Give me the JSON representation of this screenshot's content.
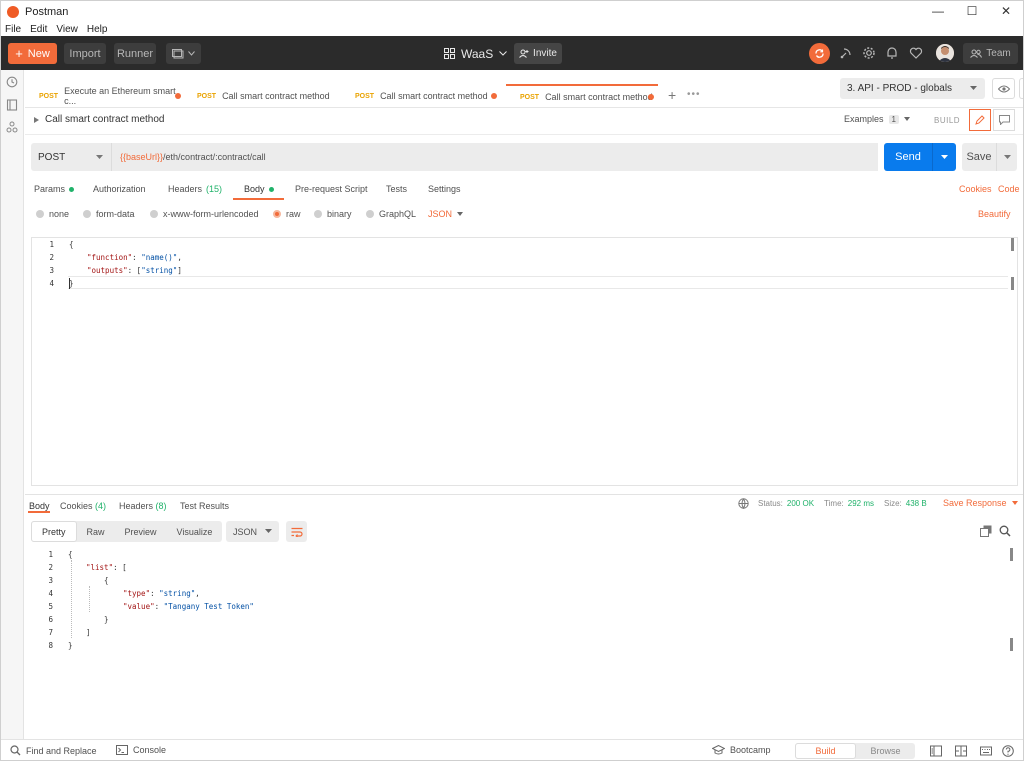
{
  "window": {
    "title": "Postman",
    "min": "—",
    "max": "☐",
    "close": "✕"
  },
  "menu": [
    "File",
    "Edit",
    "View",
    "Help"
  ],
  "header": {
    "new_label": "New",
    "import_label": "Import",
    "runner_label": "Runner",
    "workspace": "WaaS",
    "invite_label": "Invite",
    "team_label": "Team"
  },
  "tabs": [
    {
      "method": "POST",
      "label": "Execute an Ethereum smart c..."
    },
    {
      "method": "POST",
      "label": "Call smart contract method"
    },
    {
      "method": "POST",
      "label": "Call smart contract method"
    },
    {
      "method": "POST",
      "label": "Call smart contract method"
    }
  ],
  "environment": {
    "selected": "3. API - PROD - globals"
  },
  "request": {
    "name": "Call smart contract method",
    "examples_label": "Examples",
    "examples_count": "1",
    "build_label": "BUILD",
    "method": "POST",
    "url_var": "{{baseUrl}}",
    "url_rest": "/eth/contract/:contract/call",
    "send_label": "Send",
    "save_label": "Save"
  },
  "req_tabs": {
    "params": "Params",
    "authorization": "Authorization",
    "headers": "Headers",
    "headers_count": "(15)",
    "body": "Body",
    "prerequest": "Pre-request Script",
    "tests": "Tests",
    "settings": "Settings",
    "cookies": "Cookies",
    "code": "Code"
  },
  "body_types": {
    "none": "none",
    "form_data": "form-data",
    "urlencoded": "x-www-form-urlencoded",
    "raw": "raw",
    "binary": "binary",
    "graphql": "GraphQL",
    "format": "JSON",
    "beautify": "Beautify"
  },
  "request_body": [
    {
      "n": "1",
      "text": "{"
    },
    {
      "n": "2",
      "key": "\"function\"",
      "sep": ": ",
      "val": "\"name()\"",
      "end": ","
    },
    {
      "n": "3",
      "key": "\"outputs\"",
      "sep": ": [",
      "val": "\"string\"",
      "end": "]"
    },
    {
      "n": "4",
      "text": "}"
    }
  ],
  "response": {
    "body_tab": "Body",
    "cookies_tab": "Cookies",
    "cookies_count": "(4)",
    "headers_tab": "Headers",
    "headers_count": "(8)",
    "tests_tab": "Test Results",
    "status_label": "Status:",
    "status_value": "200 OK",
    "time_label": "Time:",
    "time_value": "292 ms",
    "size_label": "Size:",
    "size_value": "438 B",
    "save_response": "Save Response",
    "views": [
      "Pretty",
      "Raw",
      "Preview",
      "Visualize"
    ],
    "format": "JSON",
    "lines": [
      {
        "n": "1",
        "t": "{"
      },
      {
        "n": "2",
        "t": "\"list\": ["
      },
      {
        "n": "3",
        "t": "{"
      },
      {
        "n": "4",
        "key": "\"type\"",
        "val": "\"string\"",
        "end": ","
      },
      {
        "n": "5",
        "key": "\"value\"",
        "val": "\"Tangany Test Token\"",
        "end": ""
      },
      {
        "n": "6",
        "t": "}"
      },
      {
        "n": "7",
        "t": "]"
      },
      {
        "n": "8",
        "t": "}"
      }
    ]
  },
  "footer": {
    "find_replace": "Find and Replace",
    "console": "Console",
    "bootcamp": "Bootcamp",
    "build": "Build",
    "browse": "Browse"
  },
  "colors": {
    "accent": "#f26b3a",
    "send_blue": "#097bed",
    "method_yellow": "#e9a200",
    "status_green": "#20b26a",
    "header_dark": "#2b2b2b"
  }
}
